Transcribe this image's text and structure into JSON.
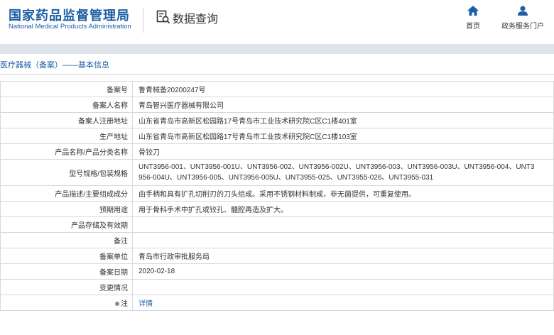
{
  "header": {
    "logo_cn": "国家药品监督管理局",
    "logo_en": "National Medical Products Administration",
    "search_title": "数据查询",
    "nav_home": "首页",
    "nav_portal": "政务服务门户",
    "brand_color": "#1d5fa6"
  },
  "breadcrumb": "医疗器械（备案）——基本信息",
  "rows": [
    {
      "label": "备案号",
      "value": "鲁青械备20200247号"
    },
    {
      "label": "备案人名称",
      "value": "青岛智兴医疗器械有限公司"
    },
    {
      "label": "备案人注册地址",
      "value": "山东省青岛市高新区松园路17号青岛市工业技术研究院C区C1楼401室"
    },
    {
      "label": "生产地址",
      "value": "山东省青岛市高新区松园路17号青岛市工业技术研究院C区C1楼103室"
    },
    {
      "label": "产品名称/产品分类名称",
      "value": "骨铰刀"
    },
    {
      "label": "型号规格/包装规格",
      "value_line1": "UNT3956-001、UNT3956-001U、UNT3956-002、UNT3956-002U、UNT3956-003、UNT3956-003U、UNT3956-004、UNT3",
      "value_line2": "956-004U、UNT3956-005、UNT3956-005U、UNT3955-025、UNT3955-026、UNT3955-031"
    },
    {
      "label": "产品描述/主要组成成分",
      "value": "由手柄和具有扩孔切削刃的刀头组成。采用不锈钢材料制成，非无菌提供，可重复使用。"
    },
    {
      "label": "预期用途",
      "value": "用于骨科手术中扩孔或铰孔、髓腔再造及扩大。"
    },
    {
      "label": "产品存储及有效期",
      "value": ""
    },
    {
      "label": "备注",
      "value": ""
    },
    {
      "label": "备案单位",
      "value": "青岛市行政审批服务局"
    },
    {
      "label": "备案日期",
      "value": "2020-02-18"
    },
    {
      "label": "变更情况",
      "value": ""
    },
    {
      "label": "注",
      "value": "详情"
    }
  ]
}
